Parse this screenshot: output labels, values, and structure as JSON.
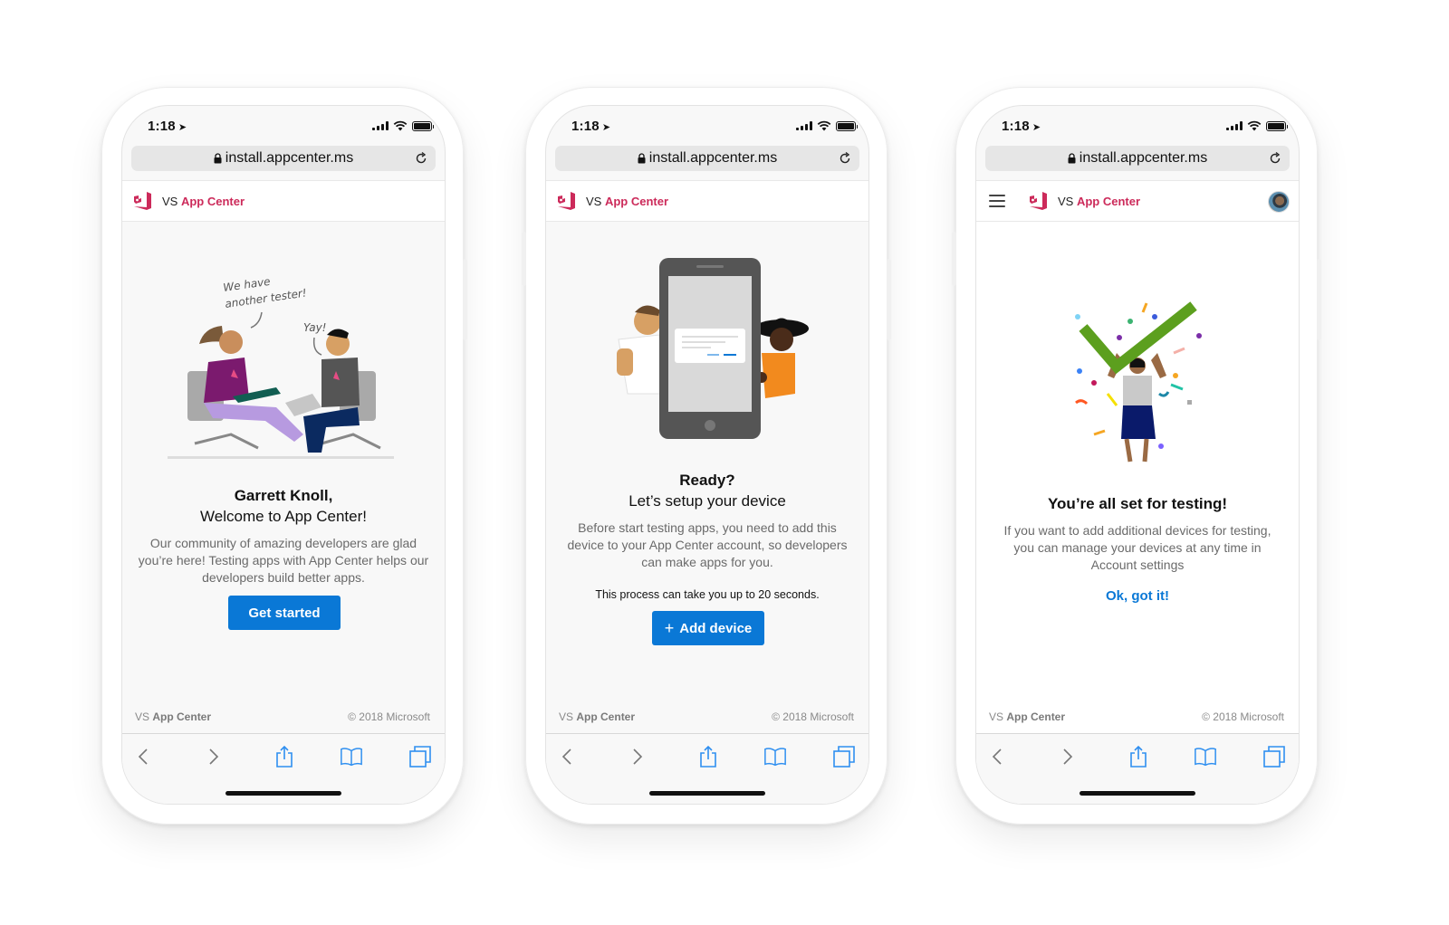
{
  "phones": [
    {
      "status": {
        "time": "1:18"
      },
      "url": "install.appcenter.ms",
      "brand": {
        "vs": "VS",
        "name": "App Center"
      },
      "illustration": {
        "speech_1": "We have another tester!",
        "speech_2": "Yay!"
      },
      "title": "Garrett Knoll,",
      "subtitle": "Welcome to App Center!",
      "body": "Our community of amazing developers are glad you’re here! Testing apps with App Center helps our developers build better apps.",
      "button": "Get started",
      "footer": {
        "vs": "VS",
        "name": "App Center",
        "copyright": "© 2018 Microsoft"
      }
    },
    {
      "status": {
        "time": "1:18"
      },
      "url": "install.appcenter.ms",
      "brand": {
        "vs": "VS",
        "name": "App Center"
      },
      "title": "Ready?",
      "subtitle": "Let’s setup your device",
      "body": "Before start testing apps, you need to add this device to your App Center account, so developers can make apps for you.",
      "note": "This process can take you up to 20 seconds.",
      "button_icon": "+",
      "button": "Add device",
      "footer": {
        "vs": "VS",
        "name": "App Center",
        "copyright": "© 2018 Microsoft"
      }
    },
    {
      "status": {
        "time": "1:18"
      },
      "url": "install.appcenter.ms",
      "brand": {
        "vs": "VS",
        "name": "App Center"
      },
      "title": "You’re all set for testing!",
      "body": "If you want to add additional devices for testing, you can manage your devices at any time in Account settings",
      "link": "Ok, got it!",
      "footer": {
        "vs": "VS",
        "name": "App Center",
        "copyright": "© 2018 Microsoft"
      }
    }
  ],
  "toolbar_icons": [
    "back-icon",
    "forward-icon",
    "share-icon",
    "bookmarks-icon",
    "tabs-icon"
  ],
  "colors": {
    "brand_pink": "#cc2a5a",
    "primary_blue": "#0a78d6",
    "toolbar_blue": "#2f8ff0"
  }
}
